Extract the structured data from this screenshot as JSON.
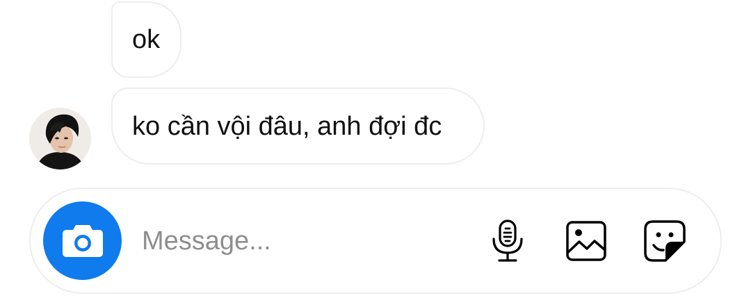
{
  "messages": [
    {
      "text": "ok",
      "sender": "other"
    },
    {
      "text": "ko cần vội đâu, anh đợi đc",
      "sender": "other"
    }
  ],
  "composer": {
    "placeholder": "Message...",
    "value": ""
  },
  "icons": {
    "camera": "camera-icon",
    "microphone": "microphone-icon",
    "gallery": "gallery-icon",
    "sticker": "sticker-icon"
  },
  "colors": {
    "accent": "#0f7bec",
    "bubble_border": "#ededed",
    "placeholder": "#8e8e8e",
    "text": "#111111"
  }
}
